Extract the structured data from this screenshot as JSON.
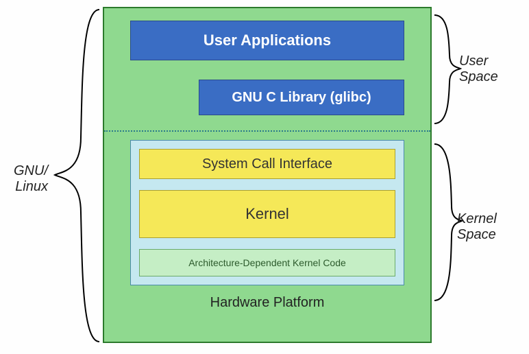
{
  "outer": {
    "gnu_linux_label_line1": "GNU/",
    "gnu_linux_label_line2": "Linux",
    "user_space_label_line1": "User",
    "user_space_label_line2": "Space",
    "kernel_space_label_line1": "Kernel",
    "kernel_space_label_line2": "Space"
  },
  "boxes": {
    "user_apps": "User Applications",
    "glibc": "GNU C Library (glibc)",
    "sci": "System Call Interface",
    "kernel": "Kernel",
    "arch_code": "Architecture-Dependent Kernel Code",
    "hardware_platform": "Hardware Platform"
  },
  "colors": {
    "platform_bg": "#8fd98f",
    "user_box": "#3a6dc4",
    "kernel_space_bg": "#c5e8f0",
    "kernel_box": "#f5e858",
    "arch_box": "#c5eec5"
  }
}
